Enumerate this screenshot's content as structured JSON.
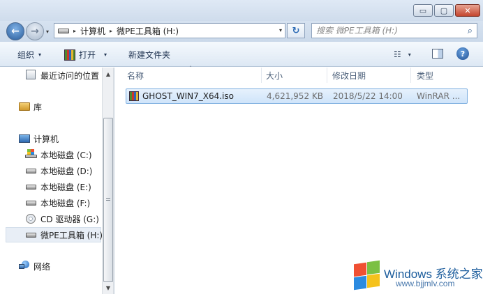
{
  "window": {
    "minimize_glyph": "▭",
    "maximize_glyph": "▢",
    "close_glyph": "✕"
  },
  "nav": {
    "back_glyph": "←",
    "forward_glyph": "→",
    "recent_dropdown_glyph": "▾"
  },
  "address": {
    "crumbs": [
      "计算机",
      "微PE工具箱 (H:)"
    ],
    "separator_glyph": "▸",
    "dropdown_glyph": "▾",
    "refresh_glyph": "↻"
  },
  "search": {
    "placeholder": "搜索 微PE工具箱 (H:)",
    "icon_glyph": "⌕"
  },
  "toolbar": {
    "organize_label": "组织",
    "open_label": "打开",
    "new_folder_label": "新建文件夹",
    "caret_glyph": "▾",
    "view_glyph": "☷",
    "help_glyph": "?"
  },
  "sidebar": {
    "items": [
      {
        "label": "最近访问的位置",
        "icon": "recent-places-icon"
      },
      {
        "label": "库",
        "icon": "library-icon"
      },
      {
        "label": "计算机",
        "icon": "computer-icon"
      },
      {
        "label": "本地磁盘 (C:)",
        "icon": "system-drive-icon"
      },
      {
        "label": "本地磁盘 (D:)",
        "icon": "drive-icon"
      },
      {
        "label": "本地磁盘 (E:)",
        "icon": "drive-icon"
      },
      {
        "label": "本地磁盘 (F:)",
        "icon": "drive-icon"
      },
      {
        "label": "CD 驱动器 (G:)",
        "icon": "cd-drive-icon"
      },
      {
        "label": "微PE工具箱 (H:)",
        "icon": "drive-icon",
        "selected": true
      },
      {
        "label": "网络",
        "icon": "network-icon"
      }
    ],
    "scroll_up_glyph": "▲",
    "scroll_down_glyph": "▼"
  },
  "columns": {
    "name": "名称",
    "size": "大小",
    "modified": "修改日期",
    "type": "类型",
    "sort_glyph": "ˆ"
  },
  "files": [
    {
      "name": "GHOST_WIN7_X64.iso",
      "size": "4,621,952 KB",
      "modified": "2018/5/22 14:00",
      "type": "WinRAR ..."
    }
  ],
  "watermark": {
    "title": "Windows 系统之家",
    "url": "www.bjjmlv.com"
  },
  "colors": {
    "accent": "#2b6bb5",
    "selection": "#cfe4fa"
  }
}
